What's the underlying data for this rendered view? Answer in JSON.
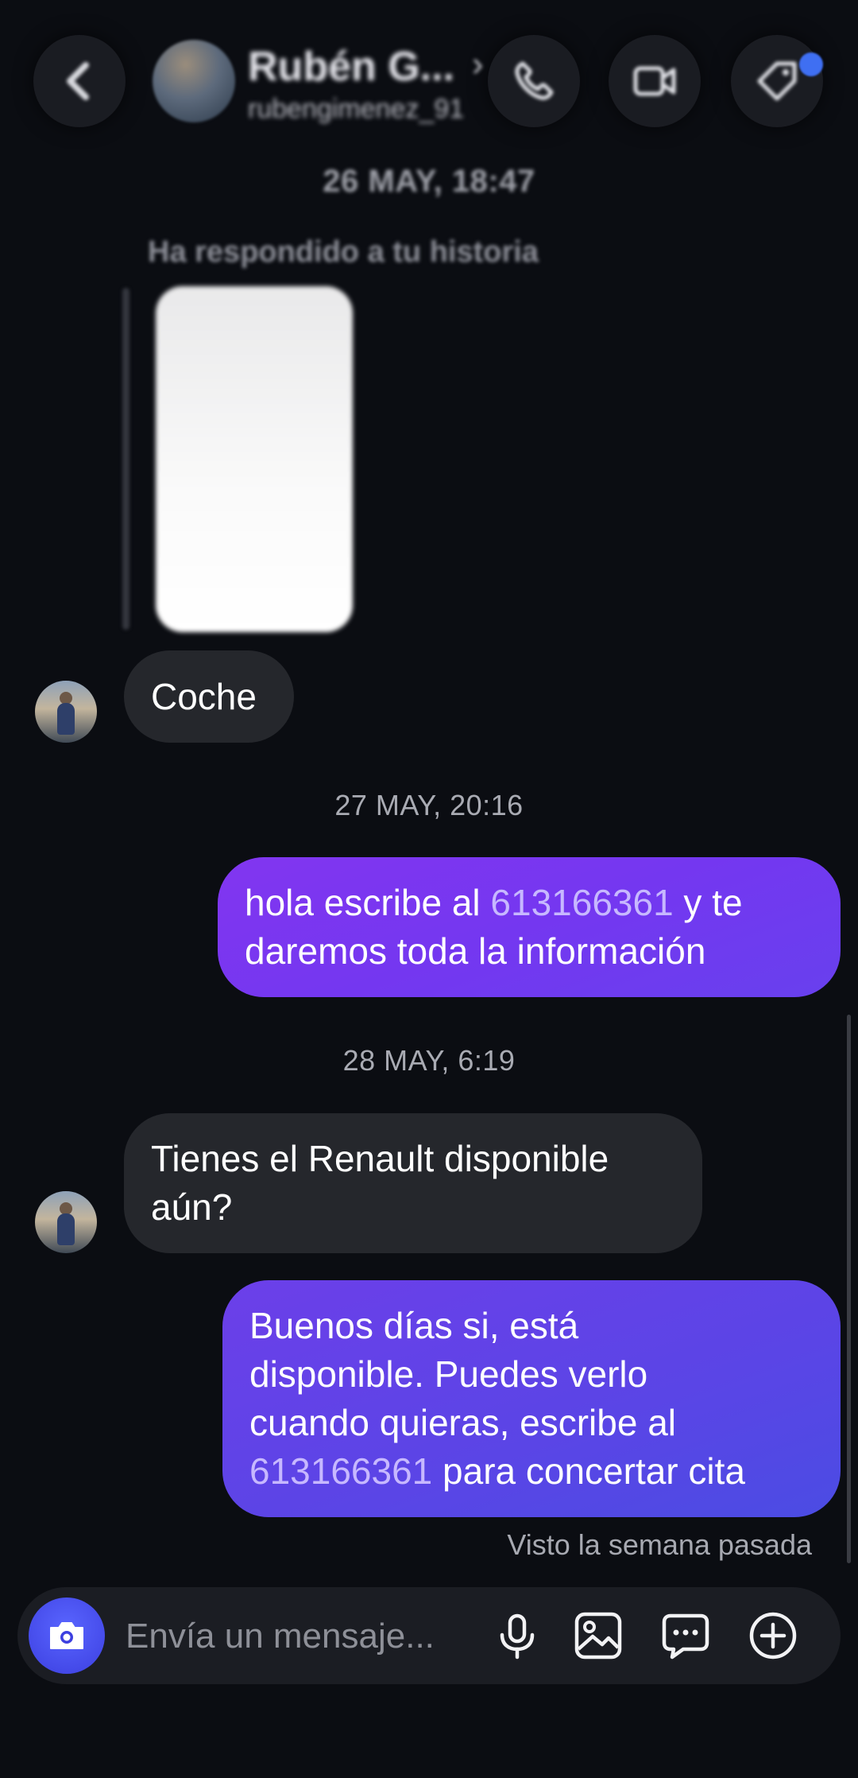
{
  "header": {
    "contact_name": "Rubén G...",
    "contact_chevron": "›",
    "contact_handle": "rubengimenez_91",
    "icons": {
      "back": "chevron-left-icon",
      "call": "phone-icon",
      "video": "video-camera-icon",
      "tag": "tag-icon"
    }
  },
  "thread": {
    "stamp_1": "26 MAY, 18:47",
    "story_reply_label": "Ha respondido a tu historia",
    "msg_1": "Coche",
    "stamp_2": "27 MAY, 20:16",
    "msg_2": {
      "before": "hola escribe al ",
      "phone": "613166361",
      "after_line1": " y te",
      "line2": "daremos toda la información"
    },
    "stamp_3": "28 MAY, 6:19",
    "msg_3": {
      "line1": "Tienes el Renault disponible",
      "line2": "aún?"
    },
    "msg_4": {
      "line1": "Buenos días si, está",
      "line2": "disponible. Puedes verlo",
      "line3": "cuando quieras, escribe al",
      "phone": "613166361",
      "after": " para concertar cita"
    },
    "seen": "Visto la semana pasada"
  },
  "composer": {
    "placeholder": "Envía un mensaje...",
    "icons": {
      "camera": "camera-icon",
      "mic": "microphone-icon",
      "gallery": "image-icon",
      "chat": "chat-bubble-icon",
      "add": "plus-circle-icon"
    }
  },
  "colors": {
    "background": "#0b0d12",
    "incoming_bubble": "#25272c",
    "outgoing_bubble": "#7a36f0",
    "accent_camera": "#3c3fe0"
  }
}
